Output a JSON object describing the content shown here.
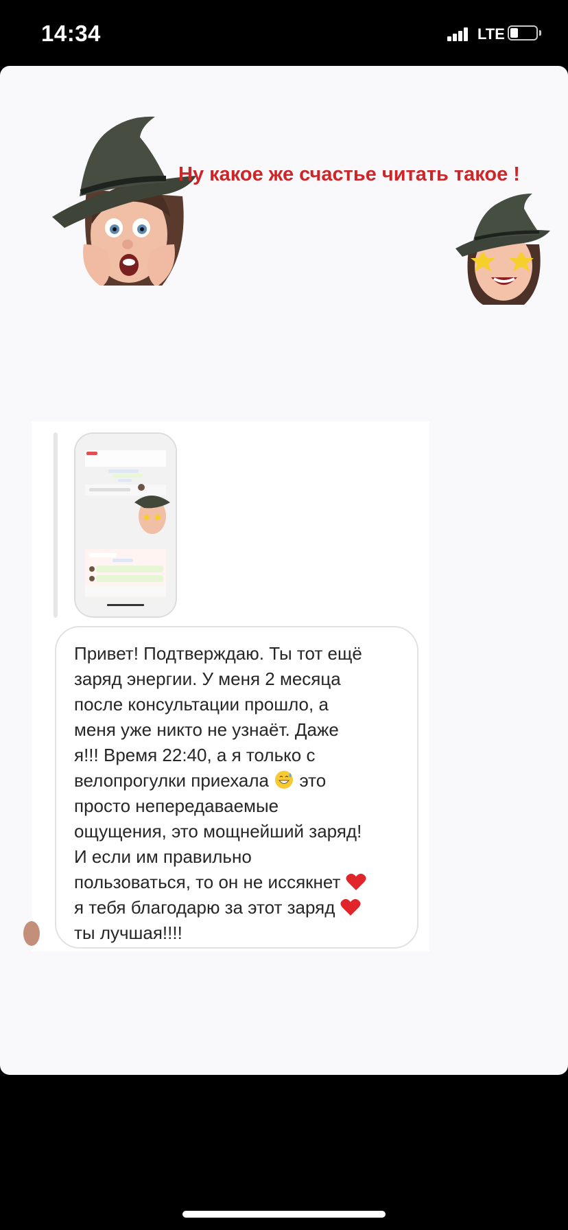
{
  "status_bar": {
    "time": "14:34",
    "network": "LTE"
  },
  "story": {
    "headline": "Ну какое же счастье читать такое !",
    "headline_color": "#cc2629"
  },
  "message": {
    "line1": "Привет! Подтверждаю. Ты тот ещё",
    "line2": "заряд энергии. У меня 2 месяца",
    "line3": "после консультации прошло, а",
    "line4": "меня уже никто не узнаёт. Даже",
    "line5": "я!!! Время 22:40, а я только с",
    "line6a": "велопрогулки приехала",
    "line6b": " это",
    "line7": "просто непередаваемые",
    "line8": "ощущения, это мощнейший заряд!",
    "line9": "И если им правильно",
    "line10": "пользоваться, то он не иссякнет",
    "line11": "я тебя благодарю за этот заряд",
    "line12": "ты лучшая!!!!"
  },
  "icons": {
    "memoji_big": "witch-memoji-surprised-icon",
    "memoji_small": "witch-memoji-star-eyes-icon",
    "emoji_sweat": "grinning-sweat-emoji-icon",
    "emoji_heart": "red-heart-emoji-icon"
  }
}
